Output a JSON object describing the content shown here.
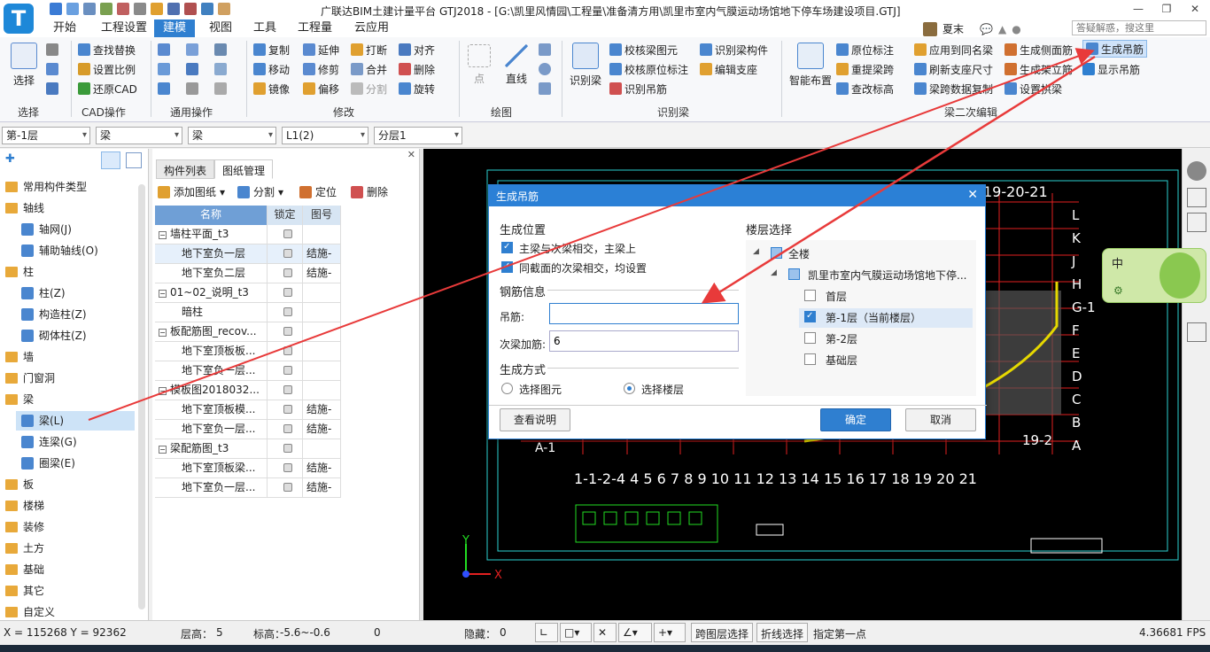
{
  "app": {
    "title": "广联达BIM土建计量平台 GTJ2018 - [G:\\凯里风情园\\工程量\\准备清方用\\凯里市室内气膜运动场馆地下停车场建设项目.GTJ]",
    "logo_letter": "T",
    "user": "夏末",
    "search_placeholder": "答疑解惑，搜这里"
  },
  "tabs": [
    "开始",
    "工程设置",
    "建模",
    "视图",
    "工具",
    "工程量",
    "云应用"
  ],
  "active_tab": "建模",
  "ribbon": {
    "select": "选择",
    "cad": [
      "查找替换",
      "设置比例",
      "还原CAD"
    ],
    "modify": [
      "复制",
      "延伸",
      "打断",
      "对齐",
      "移动",
      "修剪",
      "合并",
      "删除",
      "镜像",
      "偏移",
      "分割",
      "旋转"
    ],
    "draw": [
      "点",
      "直线"
    ],
    "identify_beam": "识别梁",
    "identify": [
      "校核梁图元",
      "识别梁构件",
      "校核原位标注",
      "编辑支座",
      "识别吊筋"
    ],
    "smart": "智能布置",
    "second_edit": [
      "原位标注",
      "应用到同名梁",
      "生成侧面筋",
      "生成吊筋",
      "重提梁跨",
      "刷新支座尺寸",
      "生成架立筋",
      "显示吊筋",
      "查改标高",
      "梁跨数据复制",
      "设置拱梁"
    ],
    "group_labels": [
      "选择",
      "CAD操作",
      "通用操作",
      "修改",
      "绘图",
      "识别梁",
      "梁二次编辑"
    ]
  },
  "selectors": [
    "第-1层",
    "梁",
    "梁",
    "L1(2)",
    "分层1"
  ],
  "nav": {
    "items": [
      {
        "label": "常用构件类型",
        "level": 0
      },
      {
        "label": "轴线",
        "level": 0
      },
      {
        "label": "轴网(J)",
        "level": 1
      },
      {
        "label": "辅助轴线(O)",
        "level": 1
      },
      {
        "label": "柱",
        "level": 0
      },
      {
        "label": "柱(Z)",
        "level": 1
      },
      {
        "label": "构造柱(Z)",
        "level": 1
      },
      {
        "label": "砌体柱(Z)",
        "level": 1
      },
      {
        "label": "墙",
        "level": 0
      },
      {
        "label": "门窗洞",
        "level": 0
      },
      {
        "label": "梁",
        "level": 0
      },
      {
        "label": "梁(L)",
        "level": 1
      },
      {
        "label": "连梁(G)",
        "level": 1
      },
      {
        "label": "圈梁(E)",
        "level": 1
      },
      {
        "label": "板",
        "level": 0
      },
      {
        "label": "楼梯",
        "level": 0
      },
      {
        "label": "装修",
        "level": 0
      },
      {
        "label": "土方",
        "level": 0
      },
      {
        "label": "基础",
        "level": 0
      },
      {
        "label": "其它",
        "level": 0
      },
      {
        "label": "自定义",
        "level": 0
      }
    ],
    "selected": "梁(L)"
  },
  "panel": {
    "tabs": [
      "构件列表",
      "图纸管理"
    ],
    "active_tab": "图纸管理",
    "toolbar": [
      "添加图纸",
      "分割",
      "定位",
      "删除"
    ],
    "columns": [
      "名称",
      "锁定",
      "图号"
    ],
    "rows": [
      {
        "name": "墙柱平面_t3",
        "group": true,
        "code": ""
      },
      {
        "name": "地下室负一层",
        "group": false,
        "code": "结施-"
      },
      {
        "name": "地下室负二层",
        "group": false,
        "code": "结施-"
      },
      {
        "name": "01~02_说明_t3",
        "group": true,
        "code": ""
      },
      {
        "name": "暗柱",
        "group": false,
        "code": ""
      },
      {
        "name": "板配筋图_recov...",
        "group": true,
        "code": ""
      },
      {
        "name": "地下室顶板板...",
        "group": false,
        "code": ""
      },
      {
        "name": "地下室负一层...",
        "group": false,
        "code": ""
      },
      {
        "name": "模板图2018032...",
        "group": true,
        "code": ""
      },
      {
        "name": "地下室顶板模...",
        "group": false,
        "code": "结施-"
      },
      {
        "name": "地下室负一层...",
        "group": false,
        "code": "结施-"
      },
      {
        "name": "梁配筋图_t3",
        "group": true,
        "code": ""
      },
      {
        "name": "地下室顶板梁...",
        "group": false,
        "code": "结施-"
      },
      {
        "name": "地下室负一层...",
        "group": false,
        "code": "结施-"
      }
    ]
  },
  "dialog": {
    "title": "生成吊筋",
    "section_position": "生成位置",
    "opt1": "主梁与次梁相交，主梁上",
    "opt2": "同截面的次梁相交，均设置",
    "section_rebar": "钢筋信息",
    "hanger_label": "吊筋:",
    "hanger_value": "",
    "secondary_label": "次梁加筋:",
    "secondary_value": "6",
    "section_method": "生成方式",
    "method1": "选择图元",
    "method2": "选择楼层",
    "section_floor": "楼层选择",
    "floors": {
      "all": "全楼",
      "project": "凯里市室内气膜运动场馆地下停...",
      "list": [
        {
          "label": "首层",
          "checked": false
        },
        {
          "label": "第-1层（当前楼层）",
          "checked": true
        },
        {
          "label": "第-2层",
          "checked": false
        },
        {
          "label": "基础层",
          "checked": false
        }
      ]
    },
    "help_button": "查看说明",
    "ok_button": "确定",
    "cancel_button": "取消"
  },
  "canvas": {
    "axis_top": "19-20-21",
    "axis_bottom_nums": "1-1-2-4  4  5  6  7  8  9 10 11 12 13 14 15 16 17 18 19 20 21",
    "axis_left": "A-1",
    "axis_right_letters": [
      "L",
      "K",
      "J",
      "H",
      "G-1",
      "F",
      "E",
      "D",
      "C",
      "B",
      "A"
    ],
    "axis_19": "19-2",
    "y_label": "Y",
    "x_label": "X",
    "widget_text": "中"
  },
  "status": {
    "coords": "X = 115268 Y = 92362",
    "floor_height_label": "层高：",
    "floor_height": "5",
    "elevation_label": "标高：",
    "elevation": "-5.6~-0.6",
    "zero": "0",
    "hidden_label": "隐藏：",
    "hidden": "0",
    "cross_layer": "跨图层选择",
    "polyline_select": "折线选择",
    "hint": "指定第一点",
    "fps": "4.36681 FPS"
  },
  "colors": {
    "accent": "#2f7fd0",
    "arrow": "#e83a3a",
    "cad_red": "#e22020",
    "cad_yellow": "#e6d800",
    "cad_green": "#22dd22"
  }
}
